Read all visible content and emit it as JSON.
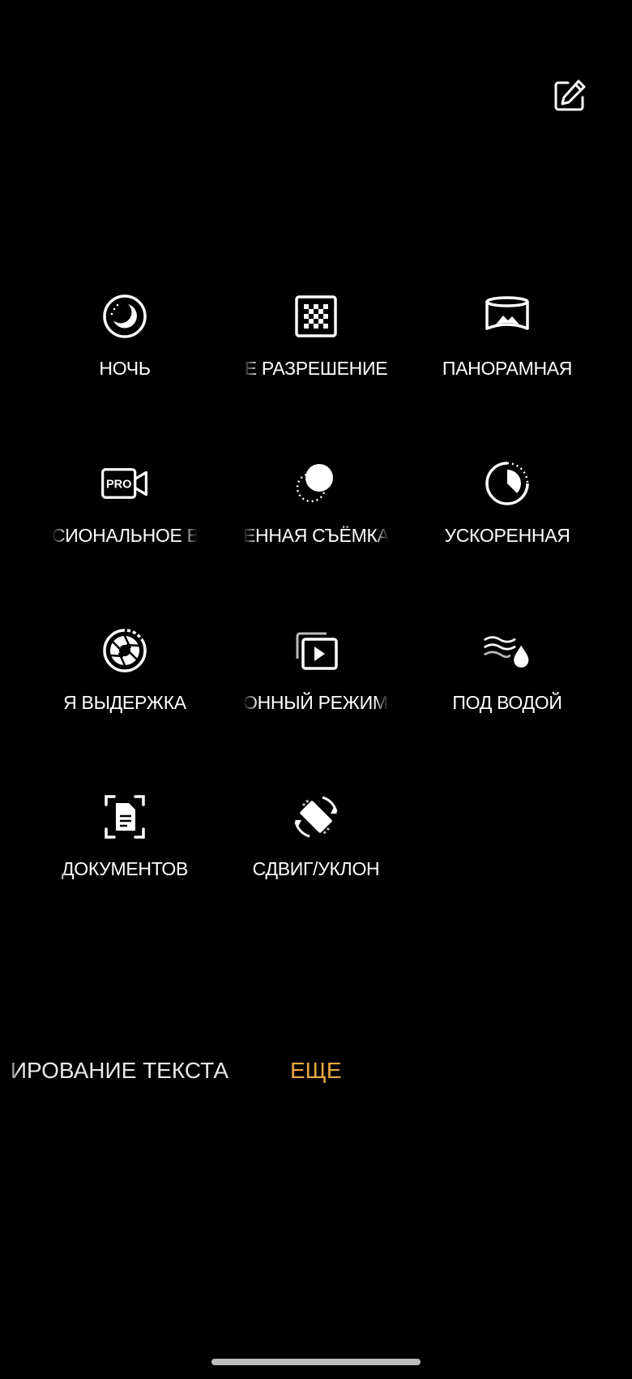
{
  "header": {
    "edit_icon": "pencil-square-icon"
  },
  "modes": [
    {
      "label": "НОЧЬ",
      "icon": "night-moon-icon"
    },
    {
      "label": "Е РАЗРЕШЕНИЕ",
      "icon": "high-resolution-icon"
    },
    {
      "label": "ПАНОРАМНАЯ",
      "icon": "panorama-icon"
    },
    {
      "label": "СИОНАЛЬНОЕ ВИ",
      "icon": "pro-video-icon"
    },
    {
      "label": "ЕННАЯ СЪЁМКА",
      "icon": "slow-motion-icon"
    },
    {
      "label": "УСКОРЕННАЯ",
      "icon": "time-lapse-icon"
    },
    {
      "label": "Я ВЫДЕРЖКА",
      "icon": "long-exposure-icon"
    },
    {
      "label": "ОННЫЙ РЕЖИМ В",
      "icon": "cinematic-video-icon"
    },
    {
      "label": "ПОД ВОДОЙ",
      "icon": "underwater-icon"
    },
    {
      "label": "ДОКУМЕНТОВ",
      "icon": "document-scan-icon"
    },
    {
      "label": "СДВИГ/УКЛОН",
      "icon": "tilt-shift-icon"
    }
  ],
  "bottom_tabs": {
    "text_scan": "ИРОВАНИЕ ТЕКСТА",
    "more": "ЕЩЕ"
  },
  "colors": {
    "background": "#000000",
    "text": "#ffffff",
    "accent": "#e9a840",
    "home_indicator": "#bdbdbd"
  }
}
